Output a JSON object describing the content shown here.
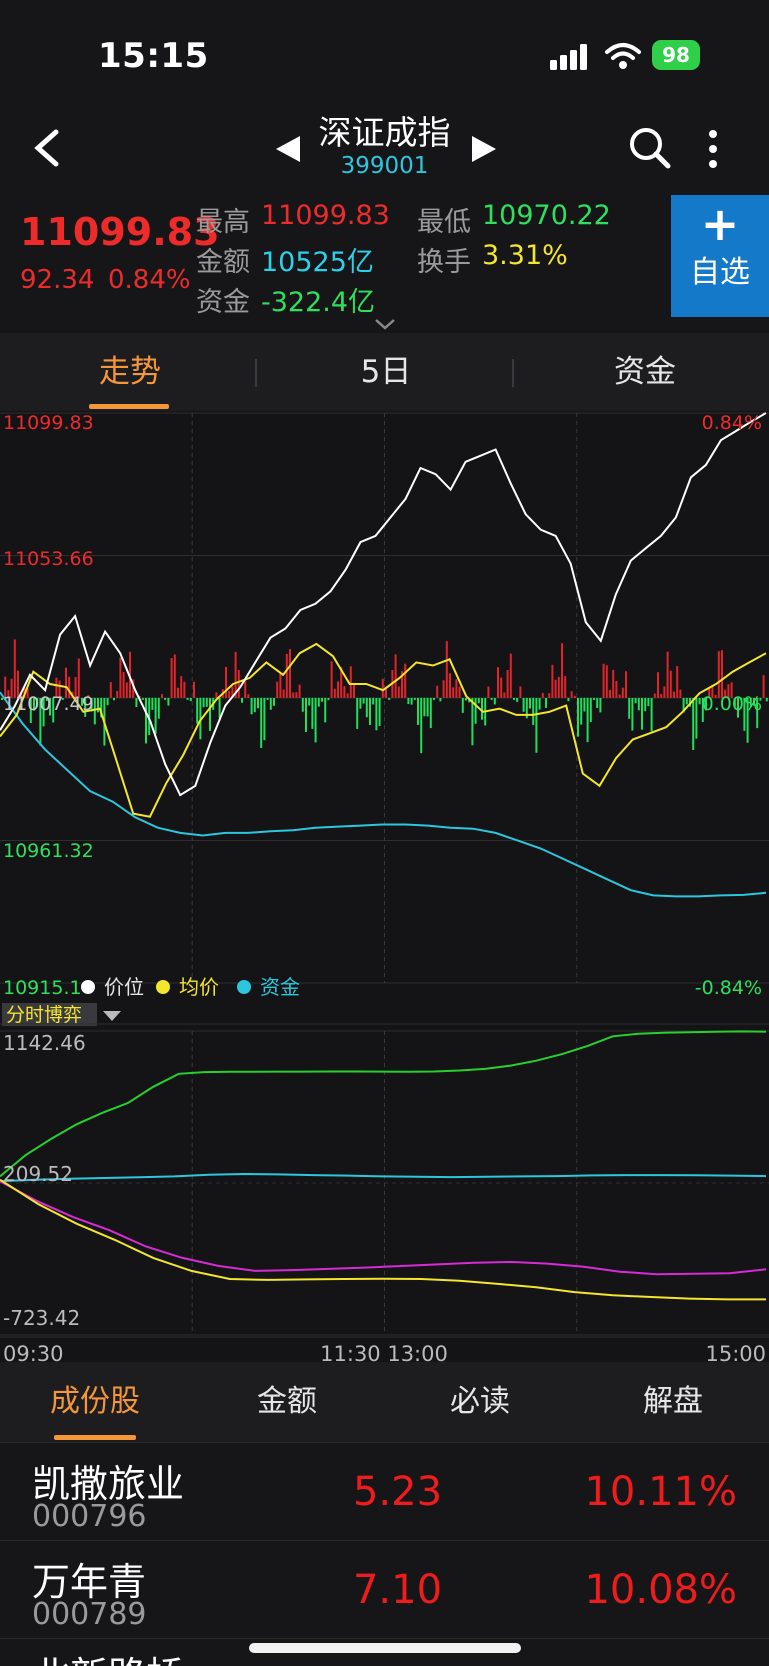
{
  "status": {
    "time": "15:15",
    "battery": "98"
  },
  "header": {
    "title": "深证成指",
    "code": "399001"
  },
  "quote": {
    "price": "11099.83",
    "change": "92.34",
    "change_pct": "0.84%",
    "high_label": "最高",
    "high": "11099.83",
    "low_label": "最低",
    "low": "10970.22",
    "amount_label": "金额",
    "amount": "10525亿",
    "turnover_label": "换手",
    "turnover": "3.31%",
    "fund_label": "资金",
    "fund": "-322.4亿",
    "add_label": "自选",
    "add_plus": "+"
  },
  "chart_tabs": [
    "走势",
    "5日",
    "资金"
  ],
  "intraday": {
    "y_labels": [
      "11099.83",
      "11053.66",
      "11007.49",
      "10961.32",
      "10915.1"
    ],
    "pct_labels": [
      "0.84%",
      "0.00%",
      "-0.84%"
    ],
    "legend": [
      "价位",
      "均价",
      "资金"
    ],
    "colors": {
      "price": "#ffffff",
      "avg": "#f3e62d",
      "fund": "#2cc7df",
      "up": "#e0242a",
      "down": "#1ee05a"
    }
  },
  "bottom_panel": {
    "title": "分时博弈",
    "y_labels": [
      "1142.46",
      "209.52",
      "-723.42"
    ],
    "x_labels": [
      "09:30",
      "11:30 13:00",
      "15:00"
    ]
  },
  "chart_data": [
    {
      "type": "line",
      "title": "",
      "series": [
        {
          "name": "价位",
          "values": [
            10997,
            11005,
            11015,
            11010,
            11028,
            11034,
            11018,
            11029,
            11022,
            11010,
            11000,
            10986,
            10976,
            10979,
            10993,
            11005,
            11011,
            11019,
            11027,
            11030,
            11036,
            11038,
            11042,
            11049,
            11058,
            11060,
            11066,
            11072,
            11082,
            11080,
            11075,
            11084,
            11086,
            11088,
            11077,
            11067,
            11062,
            11060,
            11051,
            11032,
            11026,
            11041,
            11052,
            11056,
            11060,
            11066,
            11079,
            11083,
            11091,
            11094,
            11097,
            11099.83
          ]
        },
        {
          "name": "均价",
          "values": [
            10995,
            11002,
            11016,
            11012,
            11011,
            11003,
            11004,
            10987,
            10970,
            10969,
            10980,
            10989,
            11000,
            11007,
            11012,
            11014,
            11019,
            11015,
            11022,
            11025,
            11021,
            11012,
            11012,
            11010,
            11014,
            11019,
            11018,
            11020,
            11008,
            11003,
            11004,
            11002,
            11002,
            11003,
            11005,
            10983,
            10979,
            10988,
            10994,
            10996,
            10998,
            11003,
            11009,
            11012,
            11016,
            11019,
            11022
          ]
        },
        {
          "name": "资金",
          "values": [
            -60,
            -120,
            -170,
            -210,
            -250,
            -270,
            -300,
            -320,
            -330,
            -335,
            -330,
            -330,
            -327,
            -325,
            -320,
            -318,
            -316,
            -314,
            -314,
            -316,
            -320,
            -322,
            -330,
            -345,
            -360,
            -380,
            -400,
            -420,
            -440,
            -450,
            -452,
            -452,
            -450,
            -449,
            -445
          ]
        }
      ],
      "ylim": [
        10915.1,
        11099.83
      ]
    },
    {
      "type": "line",
      "title": "",
      "series": [
        {
          "values": [
            250,
            380,
            480,
            570,
            640,
            700,
            800,
            880,
            890,
            892,
            892,
            893,
            893,
            894,
            894,
            893,
            892,
            894,
            900,
            910,
            930,
            960,
            1000,
            1050,
            1110,
            1125,
            1132,
            1135,
            1138,
            1140,
            1138
          ]
        },
        {
          "values": [
            220,
            230,
            235,
            240,
            245,
            250,
            260,
            265,
            262,
            258,
            255,
            250,
            248,
            246,
            248,
            250,
            252,
            256,
            258,
            258,
            257,
            255,
            252
          ]
        },
        {
          "values": [
            220,
            100,
            0,
            -80,
            -180,
            -250,
            -300,
            -330,
            -325,
            -318,
            -310,
            -300,
            -290,
            -280,
            -275,
            -285,
            -305,
            -335,
            -350,
            -348,
            -345,
            -320
          ]
        },
        {
          "values": [
            230,
            80,
            -40,
            -140,
            -250,
            -330,
            -380,
            -385,
            -382,
            -380,
            -378,
            -380,
            -390,
            -410,
            -430,
            -460,
            -480,
            -490,
            -500,
            -505,
            -505
          ]
        }
      ],
      "ylim": [
        -723.42,
        1142.46
      ]
    }
  ],
  "list_tabs": [
    "成份股",
    "金额",
    "必读",
    "解盘"
  ],
  "stocks": [
    {
      "name": "凯撒旅业",
      "code": "000796",
      "price": "5.23",
      "pct": "10.11%"
    },
    {
      "name": "万年青",
      "code": "000789",
      "price": "7.10",
      "pct": "10.08%"
    },
    {
      "name": "北新路桥",
      "code": "",
      "price": "",
      "pct": ""
    }
  ]
}
